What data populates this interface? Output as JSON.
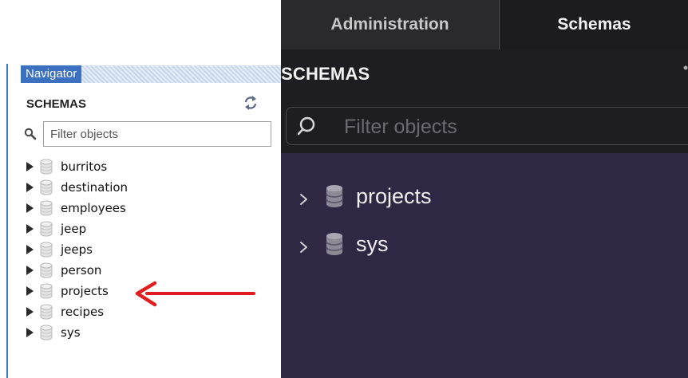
{
  "left_panel": {
    "navigator_title": "Navigator",
    "schemas_label": "SCHEMAS",
    "filter_placeholder": "Filter objects",
    "schemas": [
      "burritos",
      "destination",
      "employees",
      "jeep",
      "jeeps",
      "person",
      "projects",
      "recipes",
      "sys"
    ],
    "highlighted_schema": "projects",
    "accent_color": "#3c70c0",
    "annotation_arrow_color": "#e01e1e"
  },
  "right_panel": {
    "tabs": [
      {
        "label": "Administration",
        "active": false
      },
      {
        "label": "Schemas",
        "active": true
      }
    ],
    "schemas_label": "SCHEMAS",
    "filter_placeholder": "Filter objects",
    "schemas": [
      "projects",
      "sys"
    ],
    "tree_background": "#2f2744"
  },
  "icons": {
    "database": "database-icon",
    "expand": "expand-triangle-icon",
    "chevron": "chevron-right-icon",
    "search": "search-icon",
    "refresh": "refresh-icon",
    "annotation": "red-arrow-annotation"
  }
}
